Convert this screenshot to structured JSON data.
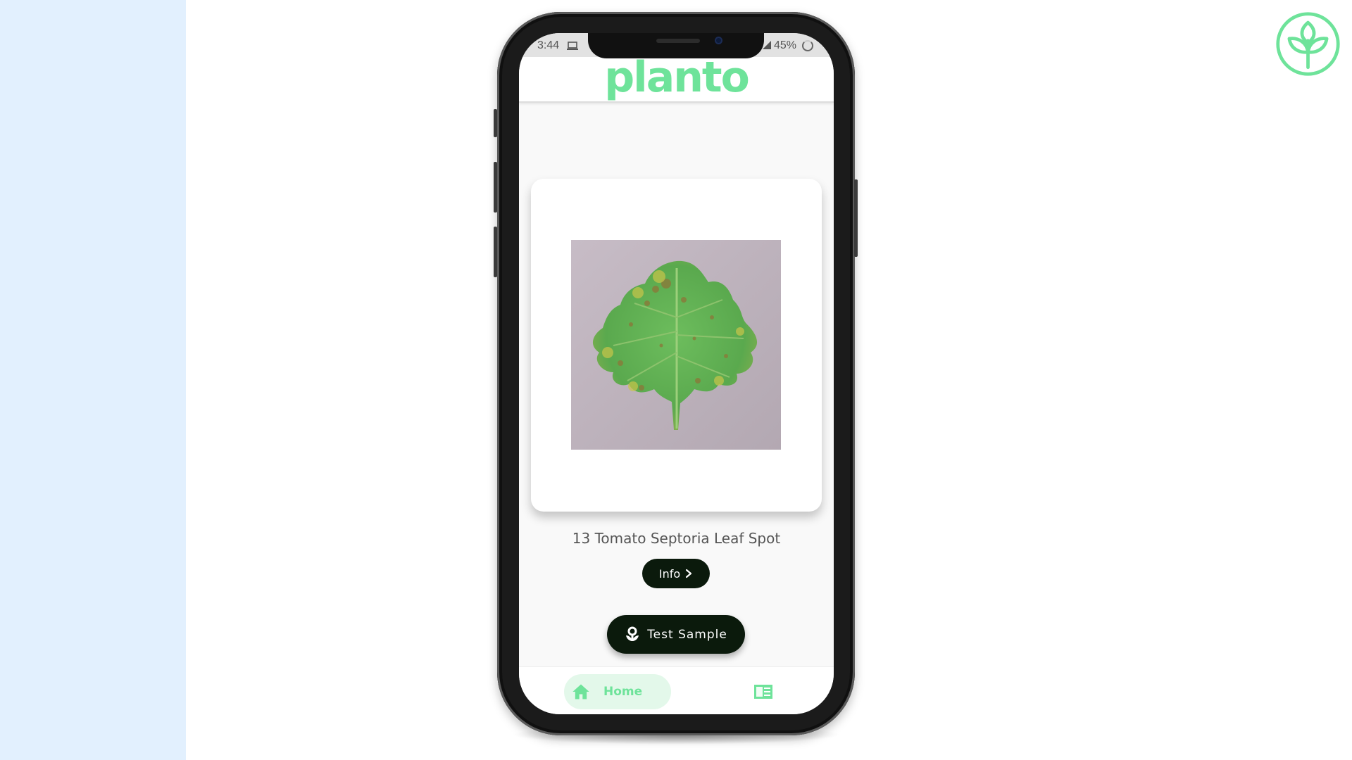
{
  "status_bar": {
    "time": "3:44",
    "battery": "45%"
  },
  "app": {
    "brand": "planto"
  },
  "result": {
    "title": "13 Tomato Septoria Leaf Spot"
  },
  "buttons": {
    "info_label": "Info",
    "test_label": "Test Sample"
  },
  "nav": {
    "items": [
      {
        "label": "Home",
        "icon": "home-icon",
        "active": true
      },
      {
        "label": "",
        "icon": "article-icon",
        "active": false
      }
    ]
  },
  "colors": {
    "brand_green": "#6ee39a",
    "button_dark": "#0b1a0c",
    "left_panel": "#e2f0fe"
  }
}
